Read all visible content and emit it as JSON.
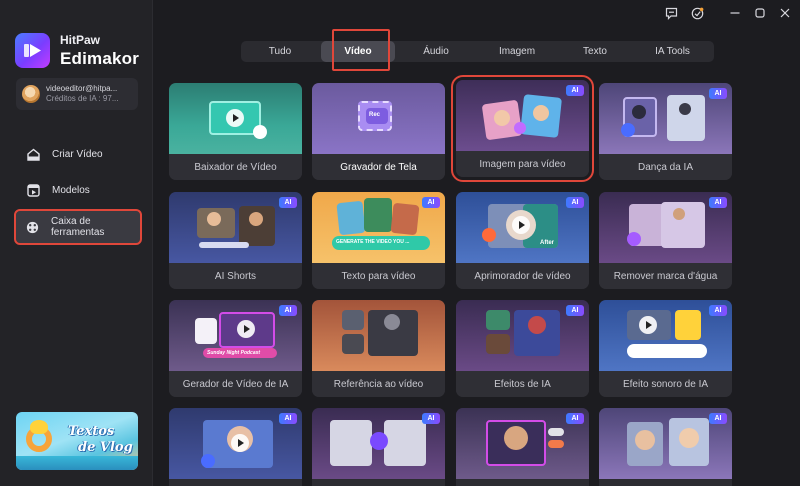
{
  "app": {
    "brand_top": "HitPaw",
    "brand_name": "Edimakor"
  },
  "account": {
    "email": "videoeditor@hitpa...",
    "credits": "Créditos de IA : 97..."
  },
  "sidebar": {
    "items": [
      {
        "label": "Criar Vídeo",
        "icon": "home-icon"
      },
      {
        "label": "Modelos",
        "icon": "templates-icon"
      },
      {
        "label": "Caixa de ferramentas",
        "icon": "toolbox-icon",
        "active": true
      }
    ],
    "promo": {
      "line1": "Textos",
      "line2": "de Vlog"
    }
  },
  "tabs": [
    {
      "label": "Tudo"
    },
    {
      "label": "Vídeo",
      "active": true
    },
    {
      "label": "Áudio"
    },
    {
      "label": "Imagem"
    },
    {
      "label": "Texto"
    },
    {
      "label": "IA Tools"
    }
  ],
  "badge": "AI",
  "tools": [
    {
      "label": "Baixador de Vídeo",
      "ai": false
    },
    {
      "label": "Gravador de Tela",
      "ai": false,
      "thumb_text": "Rec"
    },
    {
      "label": "Imagem para vídeo",
      "ai": true
    },
    {
      "label": "Dança da IA",
      "ai": true
    },
    {
      "label": "AI Shorts",
      "ai": true
    },
    {
      "label": "Texto para vídeo",
      "ai": true,
      "thumb_text": "GENERATE THE VIDEO YOU ..."
    },
    {
      "label": "Aprimorador de vídeo",
      "ai": true,
      "thumb_text": "After"
    },
    {
      "label": "Remover marca d'água",
      "ai": true
    },
    {
      "label": "Gerador de Vídeo de IA",
      "ai": true,
      "thumb_text": "Sunday Night Podcast"
    },
    {
      "label": "Referência ao vídeo",
      "ai": false
    },
    {
      "label": "Efeitos de IA",
      "ai": true
    },
    {
      "label": "Efeito sonoro de IA",
      "ai": true
    },
    {
      "label": "",
      "ai": true
    },
    {
      "label": "",
      "ai": true
    },
    {
      "label": "",
      "ai": true
    },
    {
      "label": "",
      "ai": true
    }
  ],
  "colors": {
    "highlight": "#e0473a",
    "ai_badge_start": "#3d7bff",
    "ai_badge_end": "#8a4bff",
    "background": "#1c1c20"
  }
}
